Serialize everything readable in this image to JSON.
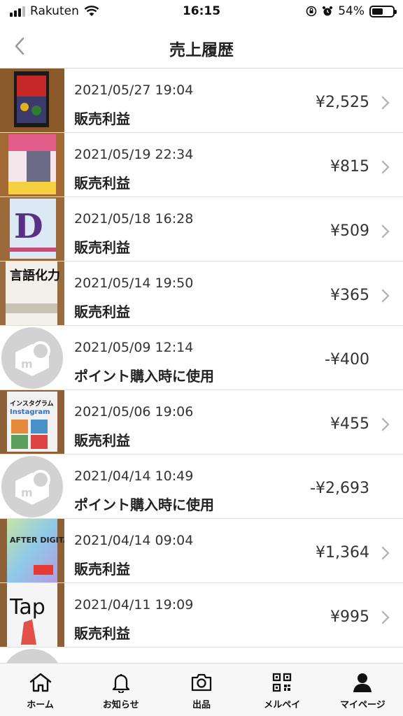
{
  "status_bar": {
    "carrier": "Rakuten",
    "time": "16:15",
    "battery": "54%",
    "battery_level": 0.54
  },
  "header": {
    "title": "売上履歴"
  },
  "transactions": [
    {
      "date": "2021/05/27 19:04",
      "label": "販売利益",
      "amount": "¥2,525",
      "type": "sale"
    },
    {
      "date": "2021/05/19 22:34",
      "label": "販売利益",
      "amount": "¥815",
      "type": "sale"
    },
    {
      "date": "2021/05/18 16:28",
      "label": "販売利益",
      "amount": "¥509",
      "type": "sale"
    },
    {
      "date": "2021/05/14 19:50",
      "label": "販売利益",
      "amount": "¥365",
      "type": "sale"
    },
    {
      "date": "2021/05/09 12:14",
      "label": "ポイント購入時に使用",
      "amount": "-¥400",
      "type": "point"
    },
    {
      "date": "2021/05/06 19:06",
      "label": "販売利益",
      "amount": "¥455",
      "type": "sale"
    },
    {
      "date": "2021/04/14 10:49",
      "label": "ポイント購入時に使用",
      "amount": "-¥2,693",
      "type": "point"
    },
    {
      "date": "2021/04/14 09:04",
      "label": "販売利益",
      "amount": "¥1,364",
      "type": "sale"
    },
    {
      "date": "2021/04/11 19:09",
      "label": "販売利益",
      "amount": "¥995",
      "type": "sale"
    }
  ],
  "thumb_texts": {
    "t3": "言語化力",
    "t5": "インスタグラム",
    "t5b": "Instagram",
    "t7": "AFTER DIGITAL",
    "t8": "Tap",
    "t2": "D"
  },
  "nav": {
    "home": "ホーム",
    "notifications": "お知らせ",
    "sell": "出品",
    "merpay": "メルペイ",
    "mypage": "マイページ"
  },
  "colors": {
    "accent": "#111111",
    "divider": "#e0e0e0",
    "point_icon": "#cfcfcf"
  }
}
